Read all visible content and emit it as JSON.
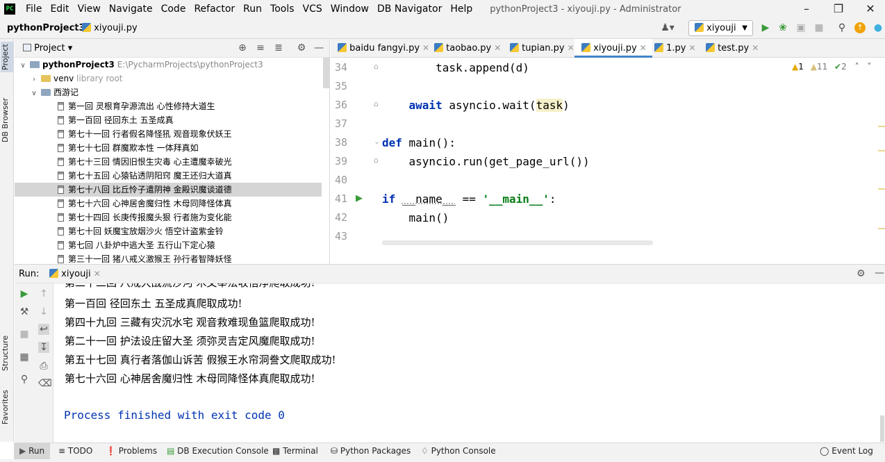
{
  "app": {
    "window_title": "pythonProject3 - xiyouji.py - Administrator",
    "menus": [
      "File",
      "Edit",
      "View",
      "Navigate",
      "Code",
      "Refactor",
      "Run",
      "Tools",
      "VCS",
      "Window",
      "DB Navigator",
      "Help"
    ]
  },
  "navbar": {
    "project": "pythonProject3",
    "file": "xiyouji.py",
    "run_config": "xiyouji"
  },
  "left_strip": {
    "project_tab": "Project",
    "db_tab": "DB Browser",
    "structure_tab": "Structure",
    "favorites_tab": "Favorites"
  },
  "project_panel": {
    "title": "Project",
    "root_name": "pythonProject3",
    "root_path": "E:\\PycharmProjects\\pythonProject3",
    "venv": "venv",
    "venv_hint": "library root",
    "folder": "西游记",
    "files": [
      "第一回 灵根育孕源流出 心性修持大道生",
      "第一百回 径回东土 五圣成真",
      "第七十一回 行者假名降怪犼 观音现象伏妖王",
      "第七十七回 群魔欺本性 一体拜真如",
      "第七十三回 情因旧恨生灾毒 心主遭魔幸破光",
      "第七十五回 心猿钻透阴阳窍 魔王还归大道真",
      "第七十八回 比丘怜子遣阴神 金殿识魔谈道德",
      "第七十六回 心神居舍魔归性 木母同降怪体真",
      "第七十四回 长庚传报魔头狠 行者施为变化能",
      "第七十回 妖魔宝放烟沙火 悟空计盗紫金铃",
      "第七回 八卦炉中逃大圣 五行山下定心猿",
      "第三十一回 猪八戒义激猴王 孙行者智降妖怪"
    ]
  },
  "editor": {
    "tabs": [
      "baidu fangyi.py",
      "taobao.py",
      "tupian.py",
      "xiyouji.py",
      "1.py",
      "test.py"
    ],
    "inspections": {
      "warn1": "1",
      "warn2": "11",
      "ok": "2"
    },
    "lines": [
      {
        "n": "34",
        "indent": "        ",
        "text": "task.append(d)"
      },
      {
        "n": "35",
        "indent": "",
        "text": ""
      },
      {
        "n": "36",
        "indent": "    ",
        "kw": "await",
        "text": " asyncio.wait(",
        "hl": "task",
        "tail": ")"
      },
      {
        "n": "37",
        "indent": "",
        "text": ""
      },
      {
        "n": "38",
        "indent": "",
        "kw": "def",
        "text": " main():"
      },
      {
        "n": "39",
        "indent": "    ",
        "text": "asyncio.run(get_page_url())"
      },
      {
        "n": "40",
        "indent": "",
        "text": ""
      },
      {
        "n": "41",
        "indent": "",
        "kw": "if",
        "dunder": "__name__",
        "op": " == ",
        "str": "'__main__'",
        "tail": ":"
      },
      {
        "n": "42",
        "indent": "    ",
        "text": "main()"
      },
      {
        "n": "43",
        "indent": "",
        "text": ""
      }
    ]
  },
  "run_panel": {
    "label": "Run:",
    "tab": "xiyouji",
    "partial_line": "第二十二回 八戒大战流沙河 木叉奉法收悟净爬取成功!",
    "output": [
      "第一百回  径回东土  五圣成真爬取成功!",
      "第四十九回  三藏有灾沉水宅  观音救难现鱼篮爬取成功!",
      "第二十一回  护法设庄留大圣  须弥灵吉定风魔爬取成功!",
      "第五十七回  真行者落伽山诉苦  假猴王水帘洞誊文爬取成功!",
      "第七十六回  心神居舍魔归性  木母同降怪体真爬取成功!"
    ],
    "finish": "Process finished with exit code 0"
  },
  "bottom_bar": {
    "tools": [
      "Run",
      "TODO",
      "Problems",
      "DB Execution Console",
      "Terminal",
      "Python Packages",
      "Python Console"
    ],
    "event_log": "Event Log"
  }
}
